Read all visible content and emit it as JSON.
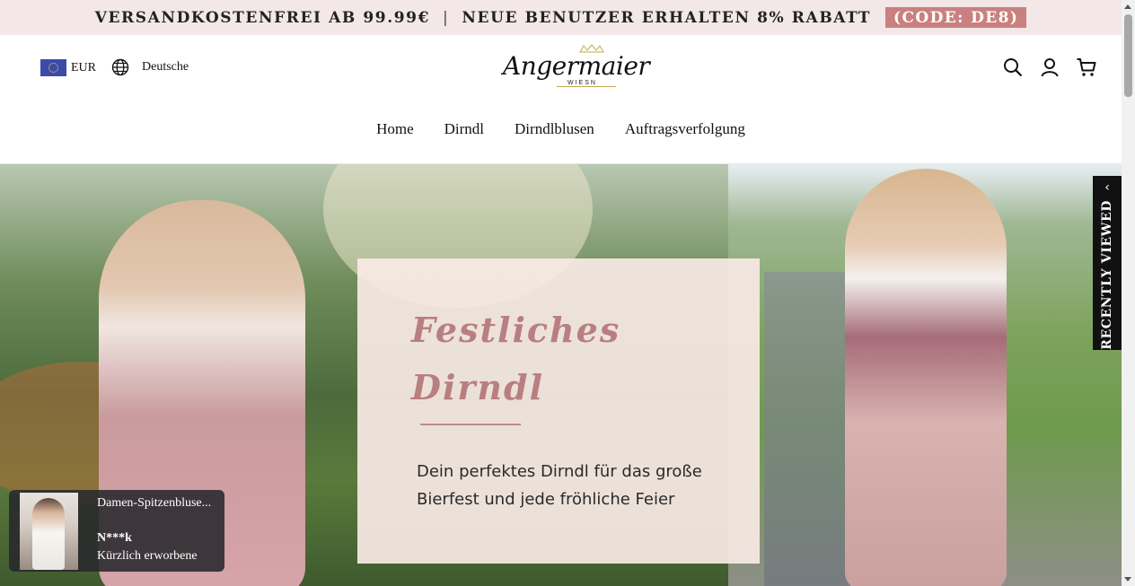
{
  "announcement": {
    "part1": "VERSANDKOSTENFREI AB 99.99€",
    "separator": "|",
    "part2": "NEUE BENUTZER ERHALTEN 8% RABATT",
    "code": "(CODE: DE8)"
  },
  "header": {
    "currency": "EUR",
    "language": "Deutsche",
    "logo": {
      "name": "Angermaier",
      "sub": "WIESN"
    },
    "icons": [
      "search-icon",
      "account-icon",
      "cart-icon"
    ]
  },
  "nav": {
    "items": [
      "Home",
      "Dirndl",
      "Dirndlblusen",
      "Auftragsverfolgung"
    ]
  },
  "hero": {
    "title_line1": "Festliches",
    "title_line2": "Dirndl",
    "text_line1": "Dein perfektes Dirndl für das große",
    "text_line2": "Bierfest und jede fröhliche Feier"
  },
  "recently_viewed": {
    "label": "RECENTLY VIEWED",
    "arrow": "‹"
  },
  "toast": {
    "product": "Damen-Spitzenbluse...",
    "buyer": "N***k",
    "status": "Kürzlich erworbene"
  },
  "colors": {
    "announcement_bg": "#f3e7e7",
    "code_badge": "#c9807f",
    "hero_title": "#b97f80"
  }
}
